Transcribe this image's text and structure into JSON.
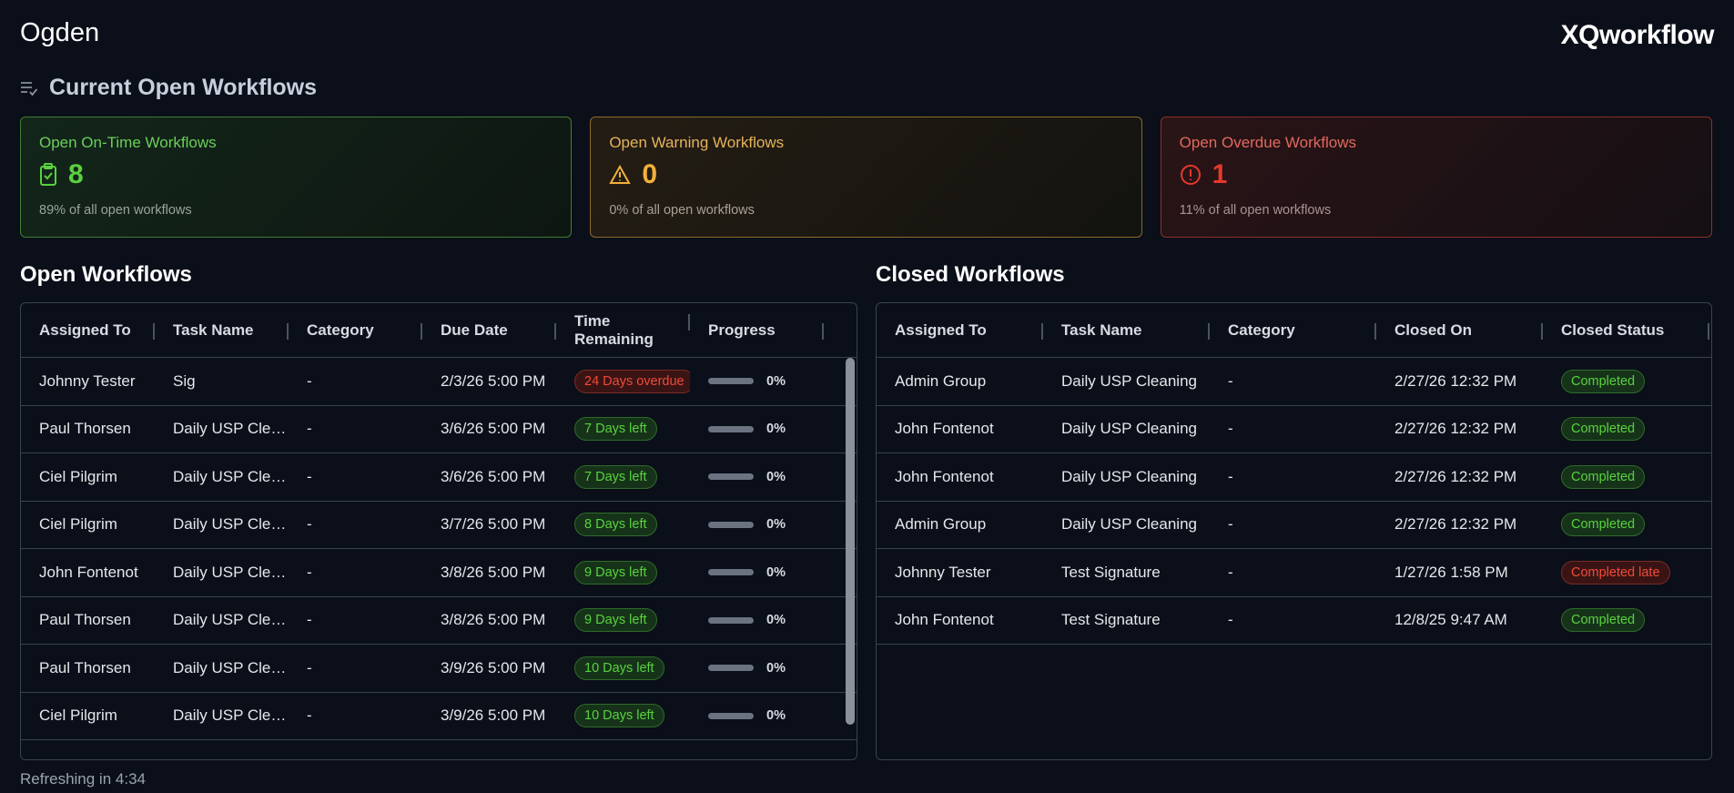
{
  "header": {
    "site": "Ogden",
    "logo": "XQworkflow"
  },
  "section": {
    "title": "Current Open Workflows",
    "icon": "list-check-icon"
  },
  "cards": [
    {
      "title": "Open On-Time Workflows",
      "value": "8",
      "subtitle": "89% of all open workflows",
      "icon": "clipboard-check-icon",
      "color": "#5ad13f"
    },
    {
      "title": "Open Warning Workflows",
      "value": "0",
      "subtitle": "0% of all open workflows",
      "icon": "warning-triangle-icon",
      "color": "#f3b03a"
    },
    {
      "title": "Open Overdue Workflows",
      "value": "1",
      "subtitle": "11% of all open workflows",
      "icon": "alert-circle-icon",
      "color": "#e5392a"
    }
  ],
  "open": {
    "title": "Open Workflows",
    "columns": [
      "Assigned To",
      "Task Name",
      "Category",
      "Due Date",
      "Time Remaining",
      "Progress"
    ],
    "rows": [
      {
        "assigned": "Johnny Tester",
        "task": "Sig",
        "category": "-",
        "due": "2/3/26 5:00 PM",
        "time": "24 Days overdue",
        "status": "overdue",
        "progress": "0%"
      },
      {
        "assigned": "Paul Thorsen",
        "task": "Daily USP Cleaning",
        "category": "-",
        "due": "3/6/26 5:00 PM",
        "time": "7 Days left",
        "status": "ok",
        "progress": "0%"
      },
      {
        "assigned": "Ciel Pilgrim",
        "task": "Daily USP Cleaning",
        "category": "-",
        "due": "3/6/26 5:00 PM",
        "time": "7 Days left",
        "status": "ok",
        "progress": "0%"
      },
      {
        "assigned": "Ciel Pilgrim",
        "task": "Daily USP Cleaning",
        "category": "-",
        "due": "3/7/26 5:00 PM",
        "time": "8 Days left",
        "status": "ok",
        "progress": "0%"
      },
      {
        "assigned": "John Fontenot",
        "task": "Daily USP Cleaning",
        "category": "-",
        "due": "3/8/26 5:00 PM",
        "time": "9 Days left",
        "status": "ok",
        "progress": "0%"
      },
      {
        "assigned": "Paul Thorsen",
        "task": "Daily USP Cleaning",
        "category": "-",
        "due": "3/8/26 5:00 PM",
        "time": "9 Days left",
        "status": "ok",
        "progress": "0%"
      },
      {
        "assigned": "Paul Thorsen",
        "task": "Daily USP Cleaning",
        "category": "-",
        "due": "3/9/26 5:00 PM",
        "time": "10 Days left",
        "status": "ok",
        "progress": "0%"
      },
      {
        "assigned": "Ciel Pilgrim",
        "task": "Daily USP Cleaning",
        "category": "-",
        "due": "3/9/26 5:00 PM",
        "time": "10 Days left",
        "status": "ok",
        "progress": "0%"
      }
    ]
  },
  "closed": {
    "title": "Closed Workflows",
    "columns": [
      "Assigned To",
      "Task Name",
      "Category",
      "Closed On",
      "Closed Status"
    ],
    "rows": [
      {
        "assigned": "Admin Group",
        "task": "Daily USP Cleaning",
        "category": "-",
        "closed": "2/27/26 12:32 PM",
        "status": "Completed"
      },
      {
        "assigned": "John Fontenot",
        "task": "Daily USP Cleaning",
        "category": "-",
        "closed": "2/27/26 12:32 PM",
        "status": "Completed"
      },
      {
        "assigned": "John Fontenot",
        "task": "Daily USP Cleaning",
        "category": "-",
        "closed": "2/27/26 12:32 PM",
        "status": "Completed"
      },
      {
        "assigned": "Admin Group",
        "task": "Daily USP Cleaning",
        "category": "-",
        "closed": "2/27/26 12:32 PM",
        "status": "Completed"
      },
      {
        "assigned": "Johnny Tester",
        "task": "Test Signature",
        "category": "-",
        "closed": "1/27/26 1:58 PM",
        "status": "Completed late"
      },
      {
        "assigned": "John Fontenot",
        "task": "Test Signature",
        "category": "-",
        "closed": "12/8/25 9:47 AM",
        "status": "Completed"
      }
    ]
  },
  "footer": {
    "refresh": "Refreshing in 4:34"
  }
}
